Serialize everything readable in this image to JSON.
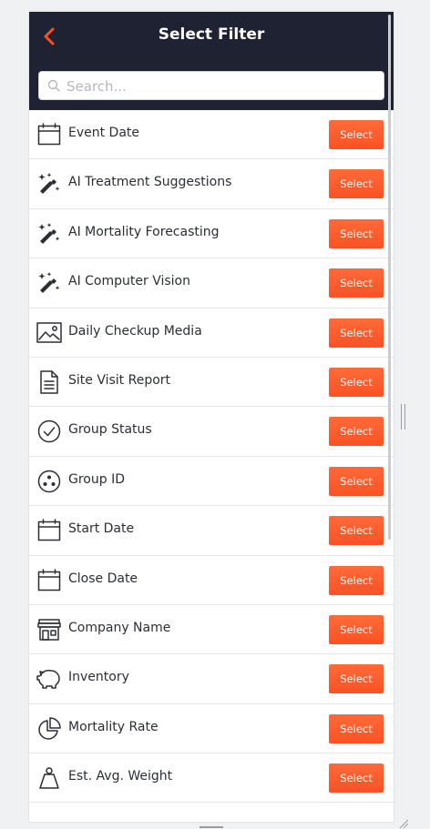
{
  "header": {
    "title": "Select Filter",
    "back_icon": "chevron-left-icon",
    "accent_color": "#fa5224",
    "background_color": "#1e2233"
  },
  "search": {
    "placeholder": "Search...",
    "value": "",
    "icon": "search-icon"
  },
  "select_button": {
    "label": "Select",
    "color": "#fa5224"
  },
  "filters": [
    {
      "label": "Event Date",
      "icon": "calendar-icon"
    },
    {
      "label": "AI Treatment Suggestions",
      "icon": "magic-wand-icon"
    },
    {
      "label": "AI Mortality Forecasting",
      "icon": "magic-wand-icon"
    },
    {
      "label": "AI Computer Vision",
      "icon": "magic-wand-icon"
    },
    {
      "label": "Daily Checkup Media",
      "icon": "image-icon"
    },
    {
      "label": "Site Visit Report",
      "icon": "document-icon"
    },
    {
      "label": "Group Status",
      "icon": "check-circle-icon"
    },
    {
      "label": "Group ID",
      "icon": "group-id-icon"
    },
    {
      "label": "Start Date",
      "icon": "calendar-icon"
    },
    {
      "label": "Close Date",
      "icon": "calendar-icon"
    },
    {
      "label": "Company Name",
      "icon": "store-icon"
    },
    {
      "label": "Inventory",
      "icon": "piggy-bank-icon"
    },
    {
      "label": "Mortality Rate",
      "icon": "pie-chart-icon"
    },
    {
      "label": "Est. Avg. Weight",
      "icon": "weight-icon"
    }
  ]
}
